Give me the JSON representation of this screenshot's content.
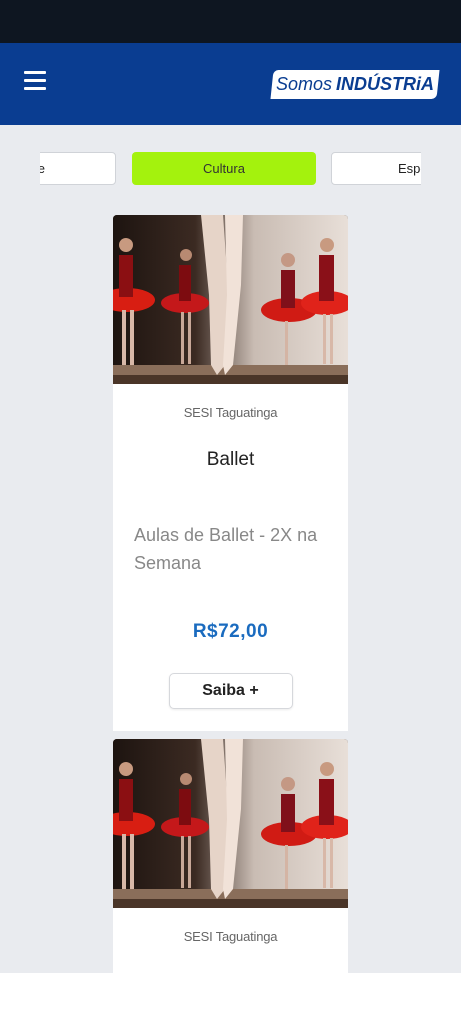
{
  "header": {
    "menu_icon": "hamburger-menu-icon",
    "brand_light": "Somos",
    "brand_bold": "INDÚSTRiA",
    "header_color": "#0a3d91",
    "status_bar_color": "#0e1621"
  },
  "tabs": {
    "prev_label": "e",
    "active_label": "Cultura",
    "next_label": "Espo",
    "active_color": "#a4f20d"
  },
  "cards": [
    {
      "location": "SESI Taguatinga",
      "title": "Ballet",
      "description": "Aulas de Ballet - 2X na Semana",
      "price": "R$72,00",
      "button_label": "Saiba +"
    },
    {
      "location": "SESI Taguatinga"
    }
  ],
  "price_color": "#1a6bbf"
}
